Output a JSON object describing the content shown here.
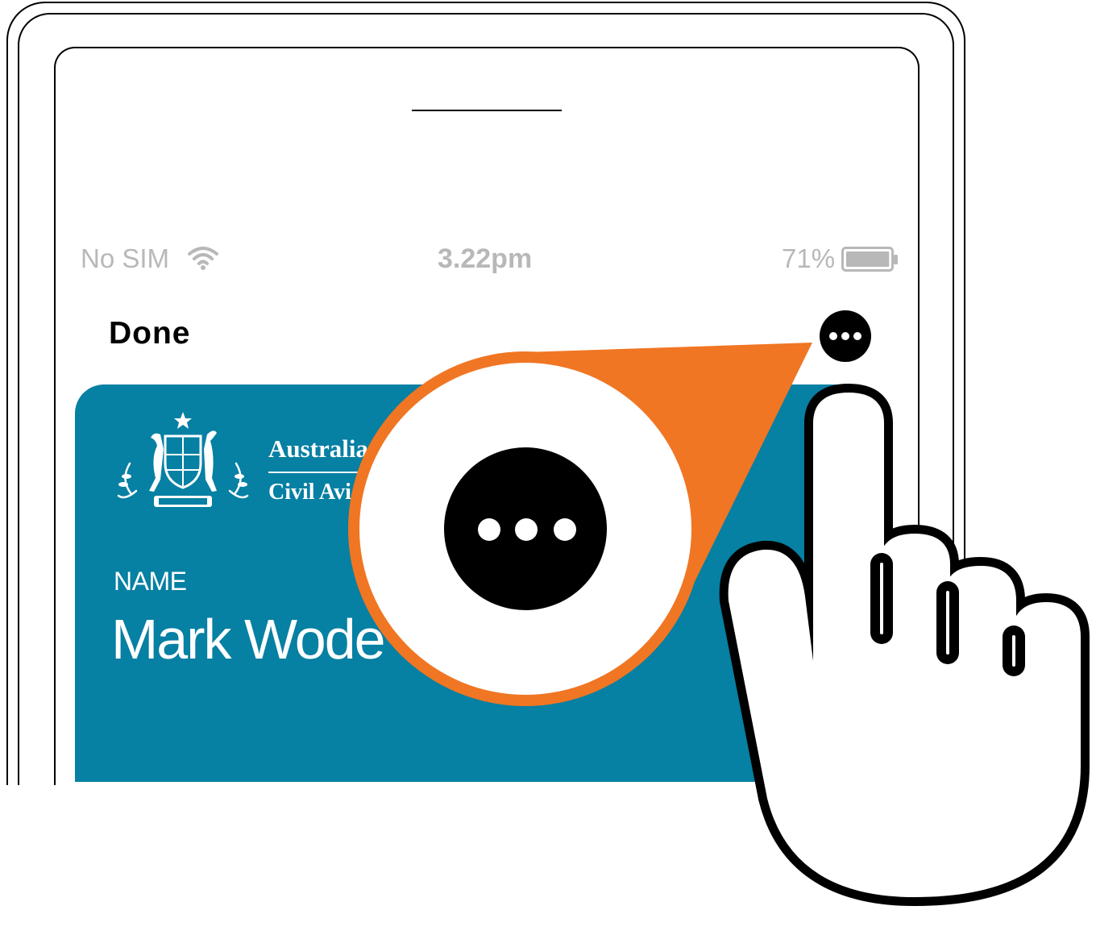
{
  "status_bar": {
    "carrier": "No SIM",
    "time": "3.22pm",
    "battery_percent": "71%",
    "battery_level": 0.71
  },
  "nav": {
    "done_label": "Done",
    "more_icon": "more-horizontal-icon"
  },
  "card": {
    "agency_line1": "Australia",
    "agency_line2": "Civil Avi",
    "crest_icon": "coat-of-arms-icon",
    "name_label": "NAME",
    "name_value": "Mark Wode"
  },
  "callout": {
    "icon": "more-horizontal-icon",
    "accent": "#f07623"
  },
  "pointer_icon": "pointing-hand-icon",
  "colors": {
    "card_blue": "#0680a3",
    "status_gray": "#b8b8b8",
    "accent_orange": "#f07623"
  }
}
